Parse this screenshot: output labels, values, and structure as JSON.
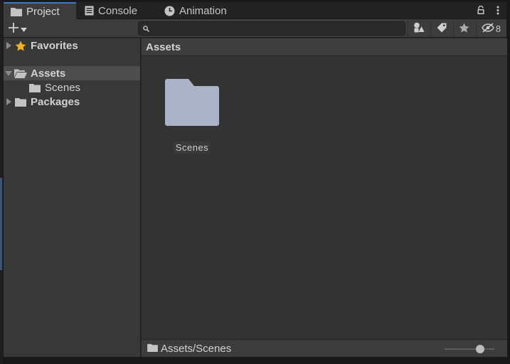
{
  "tabs": [
    {
      "label": "Project",
      "icon": "folder-icon",
      "active": true
    },
    {
      "label": "Console",
      "icon": "console-icon",
      "active": false
    },
    {
      "label": "Animation",
      "icon": "clock-icon",
      "active": false
    }
  ],
  "toolbar": {
    "create_icon": "plus-icon",
    "search_placeholder": "",
    "search_value": "",
    "hidden_count": "8"
  },
  "tree": {
    "favorites": "Favorites",
    "assets": "Assets",
    "scenes": "Scenes",
    "packages": "Packages"
  },
  "content": {
    "breadcrumb": "Assets",
    "items": [
      {
        "label": "Scenes",
        "icon": "folder-icon"
      }
    ]
  },
  "status": {
    "path": "Assets/Scenes",
    "zoom_fraction": 0.75
  },
  "colors": {
    "tab_accent": "#3a79bb",
    "folder_large": "#aab3c8",
    "favorite_star": "#f2b21a"
  }
}
